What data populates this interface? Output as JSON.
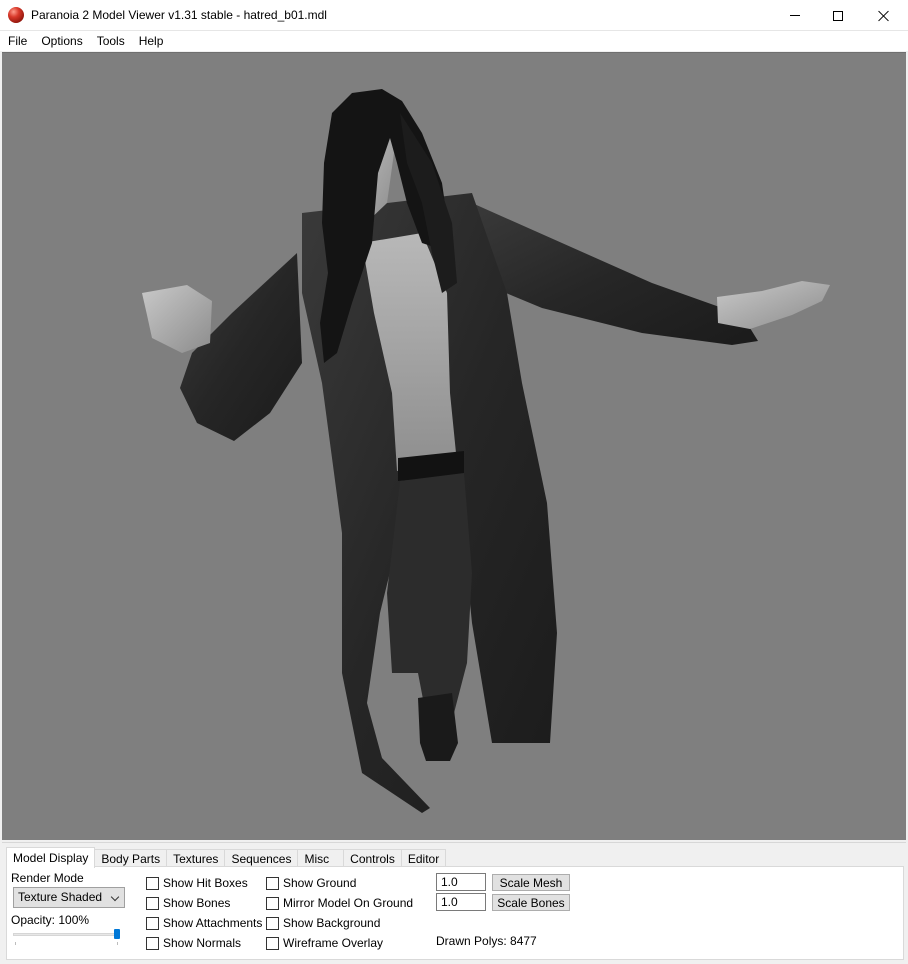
{
  "window": {
    "title": "Paranoia 2 Model Viewer v1.31 stable - hatred_b01.mdl",
    "icon": "app-orb-icon"
  },
  "menu": [
    "File",
    "Options",
    "Tools",
    "Help"
  ],
  "viewport": {
    "background": "#7f7f7f",
    "model_file": "hatred_b01.mdl"
  },
  "tabs": [
    "Model Display",
    "Body Parts",
    "Textures",
    "Sequences",
    "Misc",
    "Controls",
    "Editor"
  ],
  "model_display": {
    "render_mode_label": "Render Mode",
    "render_mode_value": "Texture Shaded",
    "opacity_label": "Opacity: 100%",
    "opacity_value": 1.0,
    "checkboxes_col1": [
      {
        "label": "Show Hit Boxes",
        "checked": false
      },
      {
        "label": "Show Bones",
        "checked": false
      },
      {
        "label": "Show Attachments",
        "checked": false
      },
      {
        "label": "Show Normals",
        "checked": false
      }
    ],
    "checkboxes_col2": [
      {
        "label": "Show Ground",
        "checked": false
      },
      {
        "label": "Mirror Model On Ground",
        "checked": false
      },
      {
        "label": "Show Background",
        "checked": false
      },
      {
        "label": "Wireframe Overlay",
        "checked": false
      }
    ],
    "scale_mesh_value": "1.0",
    "scale_mesh_label": "Scale Mesh",
    "scale_bones_value": "1.0",
    "scale_bones_label": "Scale Bones",
    "drawn_polys": "Drawn Polys: 8477"
  },
  "colors": {
    "accent": "#0078d7",
    "viewport_bg": "#7f7f7f"
  }
}
